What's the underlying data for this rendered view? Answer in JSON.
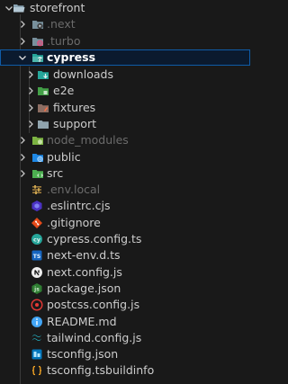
{
  "tree": {
    "root": "storefront",
    "next_dir": ".next",
    "turbo_dir": ".turbo",
    "cypress_dir": "cypress",
    "cypress_children": [
      "downloads",
      "e2e",
      "fixtures",
      "support"
    ],
    "node_modules_dir": "node_modules",
    "public_dir": "public",
    "src_dir": "src",
    "files": [
      ".env.local",
      ".eslintrc.cjs",
      ".gitignore",
      "cypress.config.ts",
      "next-env.d.ts",
      "next.config.js",
      "package.json",
      "postcss.config.js",
      "README.md",
      "tailwind.config.js",
      "tsconfig.json",
      "tsconfig.tsbuildinfo"
    ]
  },
  "icons": {
    "folder": "folder-icon",
    "next": "nextjs-folder-icon",
    "turbo": "turbo-folder-icon",
    "cypress": "cypress-folder-icon",
    "downloads": "downloads-folder-icon",
    "e2e": "e2e-folder-icon",
    "fixtures": "fixtures-folder-icon",
    "node_modules": "node-modules-folder-icon",
    "public": "public-folder-icon",
    "src": "src-folder-icon"
  },
  "colors": {
    "background": "#191919",
    "selection_border": "#0f5ca8",
    "selection_fill": "#0b1a2e",
    "text": "#cccccc",
    "dim_text": "#6b6b6b"
  }
}
